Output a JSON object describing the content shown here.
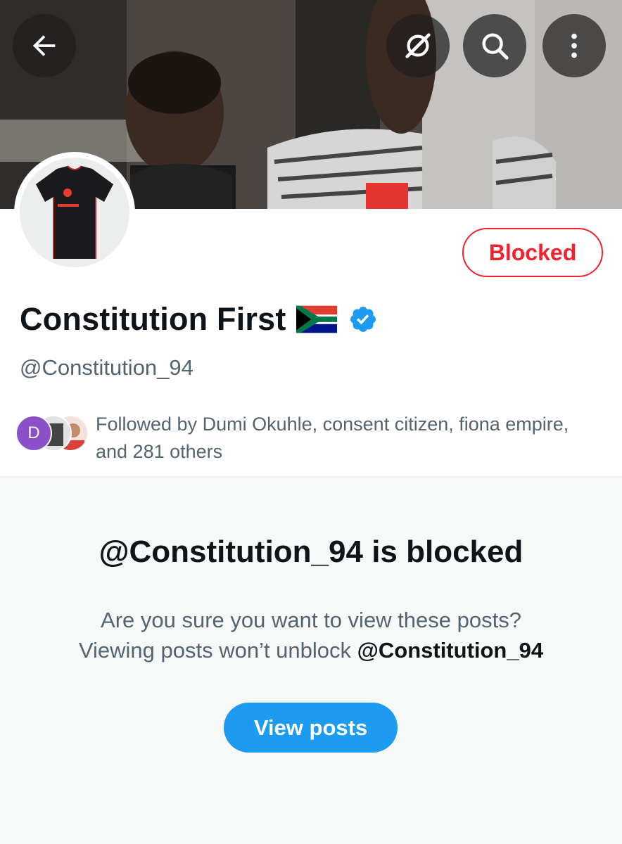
{
  "header": {
    "back_icon": "arrow-left-icon",
    "grok_icon": "grok-icon",
    "search_icon": "search-icon",
    "more_icon": "more-vertical-icon"
  },
  "profile": {
    "display_name": "Constitution First",
    "flag_emoji": "🇿🇦",
    "verified": true,
    "handle": "@Constitution_94",
    "block_status_label": "Blocked",
    "followed_by": {
      "avatar_letter": "D",
      "text": "Followed by Dumi Okuhle, consent citizen, fiona empire, and 281 others"
    }
  },
  "blocked_panel": {
    "title": "@Constitution_94 is blocked",
    "line1": "Are you sure you want to view these posts?",
    "line2_prefix": "Viewing posts won’t unblock ",
    "line2_handle": "@Constitution_94",
    "view_button": "View posts"
  },
  "colors": {
    "accent_blue": "#1d9bf0",
    "blocked_red": "#f4212e",
    "secondary_text": "#536471",
    "panel_bg": "#f7f9f9"
  }
}
